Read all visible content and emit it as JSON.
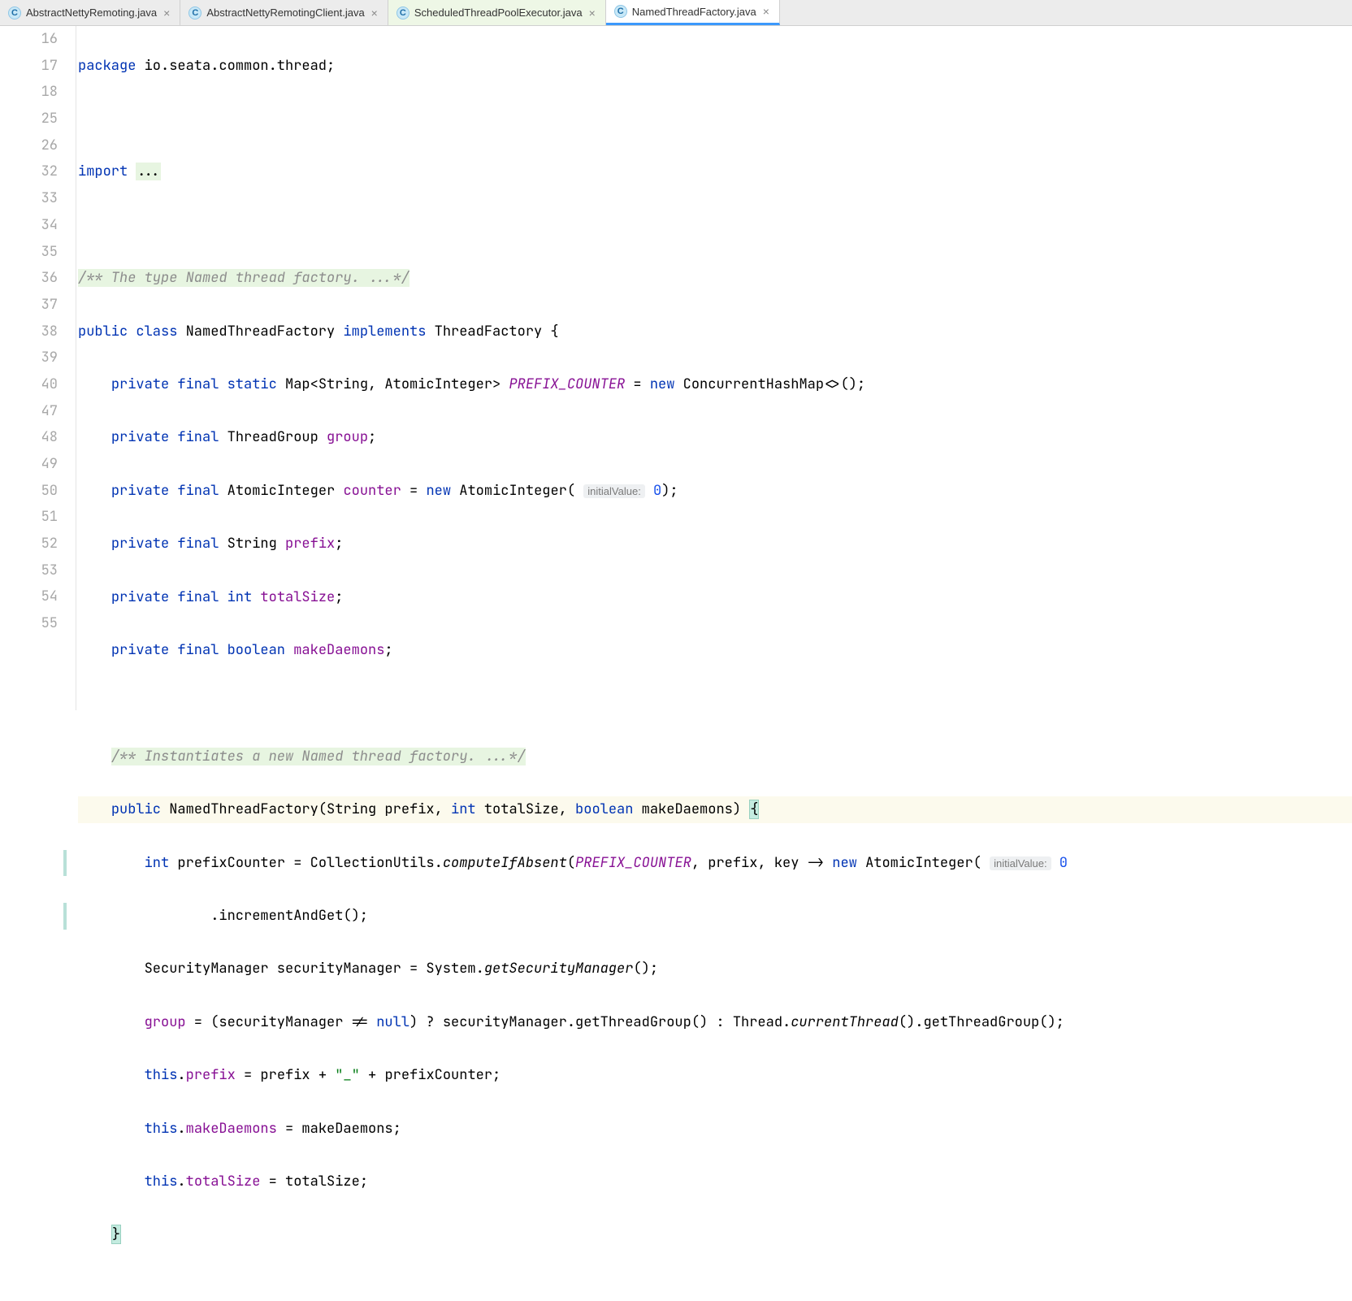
{
  "tabs": [
    {
      "label": "AbstractNettyRemoting.java",
      "active": false,
      "highlighted": false
    },
    {
      "label": "AbstractNettyRemotingClient.java",
      "active": false,
      "highlighted": false
    },
    {
      "label": "ScheduledThreadPoolExecutor.java",
      "active": false,
      "highlighted": true
    },
    {
      "label": "NamedThreadFactory.java",
      "active": true,
      "highlighted": false
    }
  ],
  "gutter": [
    "16",
    "17",
    "18",
    "25",
    "26",
    "32",
    "33",
    "34",
    "35",
    "36",
    "37",
    "38",
    "39",
    "40",
    "47",
    "48",
    "49",
    "50",
    "51",
    "52",
    "53",
    "54",
    "55"
  ],
  "code": {
    "l16": {
      "kw1": "package",
      "t": " io.seata.common.thread;"
    },
    "l18": {
      "kw1": "import ",
      "rest": "..."
    },
    "l26": {
      "doc": "/** The type Named thread factory. ...*/"
    },
    "l32": {
      "kw1": "public class ",
      "name": "NamedThreadFactory ",
      "kw2": "implements ",
      "iface": "ThreadFactory {"
    },
    "l33": {
      "kw": "private final static ",
      "type": "Map<String, AtomicInteger> ",
      "field": "PREFIX_COUNTER",
      "eq": " = ",
      "kw2": "new ",
      "ctor": "ConcurrentHashMap<>();"
    },
    "l34": {
      "kw": "private final ",
      "type": "ThreadGroup ",
      "field": "group",
      "end": ";"
    },
    "l35": {
      "kw": "private final ",
      "type": "AtomicInteger ",
      "field": "counter",
      "eq": " = ",
      "kw2": "new ",
      "ctor": "AtomicInteger(",
      "hint": "initialValue:",
      "num": " 0",
      "end": ");"
    },
    "l36": {
      "kw": "private final ",
      "type": "String ",
      "field": "prefix",
      "end": ";"
    },
    "l37": {
      "kw": "private final int ",
      "field": "totalSize",
      "end": ";"
    },
    "l38": {
      "kw": "private final boolean ",
      "field": "makeDaemons",
      "end": ";"
    },
    "l40": {
      "doc": "/** Instantiates a new Named thread factory. ...*/"
    },
    "l47": {
      "kw": "public ",
      "name": "NamedThreadFactory",
      "p1": "(String prefix, ",
      "kw2": "int ",
      "p2": "totalSize, ",
      "kw3": "boolean ",
      "p3": "makeDaemons) ",
      "brace": "{"
    },
    "l48": {
      "kw": "int ",
      "var": "prefixCounter = CollectionUtils.",
      "m": "computeIfAbsent",
      "p1": "(",
      "f": "PREFIX_COUNTER",
      "p2": ", prefix, key -> ",
      "kw2": "new ",
      "ctor": "AtomicInteger(",
      "hint": "initialValue:",
      "num": " 0"
    },
    "l49": {
      "t": ".incrementAndGet();"
    },
    "l50": {
      "t1": "SecurityManager securityManager = System.",
      "m": "getSecurityManager",
      "t2": "();"
    },
    "l51": {
      "f": "group",
      "t1": " = (securityManager != ",
      "kw": "null",
      "t2": ") ? securityManager.getThreadGroup() : Thread.",
      "m": "currentThread",
      "t3": "().getThreadGroup();"
    },
    "l52": {
      "kw": "this",
      "t1": ".",
      "f": "prefix",
      "t2": " = prefix + ",
      "s": "\"_\"",
      "t3": " + prefixCounter;"
    },
    "l53": {
      "kw": "this",
      "t1": ".",
      "f": "makeDaemons",
      "t2": " = makeDaemons;"
    },
    "l54": {
      "kw": "this",
      "t1": ".",
      "f": "totalSize",
      "t2": " = totalSize;"
    },
    "l55": {
      "brace": "}"
    }
  }
}
